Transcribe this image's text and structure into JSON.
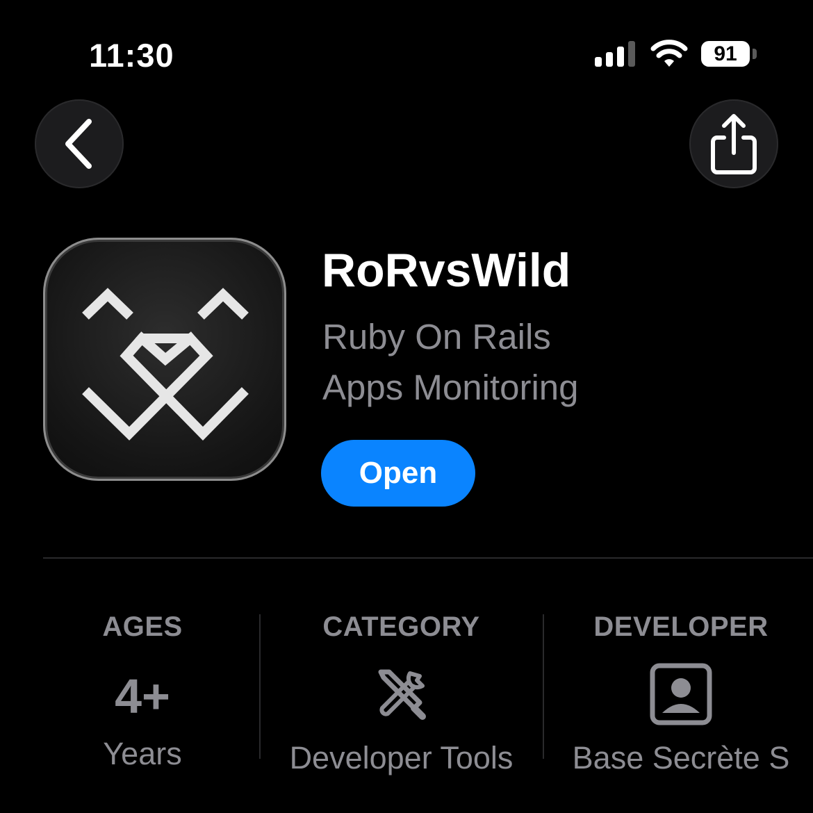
{
  "status_bar": {
    "time": "11:30",
    "battery": "91",
    "icons": [
      "signal-icon",
      "wifi-icon",
      "battery-icon"
    ]
  },
  "nav": {
    "back_icon": "chevron-left-icon",
    "share_icon": "share-icon"
  },
  "app": {
    "name": "RoRvsWild",
    "subtitle_line1": "Ruby On Rails",
    "subtitle_line2": "Apps Monitoring",
    "open_label": "Open",
    "icon": "rorvswild-logo"
  },
  "info": {
    "ages": {
      "label": "AGES",
      "value": "4+",
      "sub": "Years"
    },
    "category": {
      "label": "CATEGORY",
      "icon": "tools-icon",
      "sub": "Developer Tools"
    },
    "developer": {
      "label": "DEVELOPER",
      "icon": "person-icon",
      "sub": "Base Secrète S"
    }
  },
  "colors": {
    "background": "#000000",
    "accent": "#0a84ff",
    "secondary_text": "#8d8d93"
  }
}
